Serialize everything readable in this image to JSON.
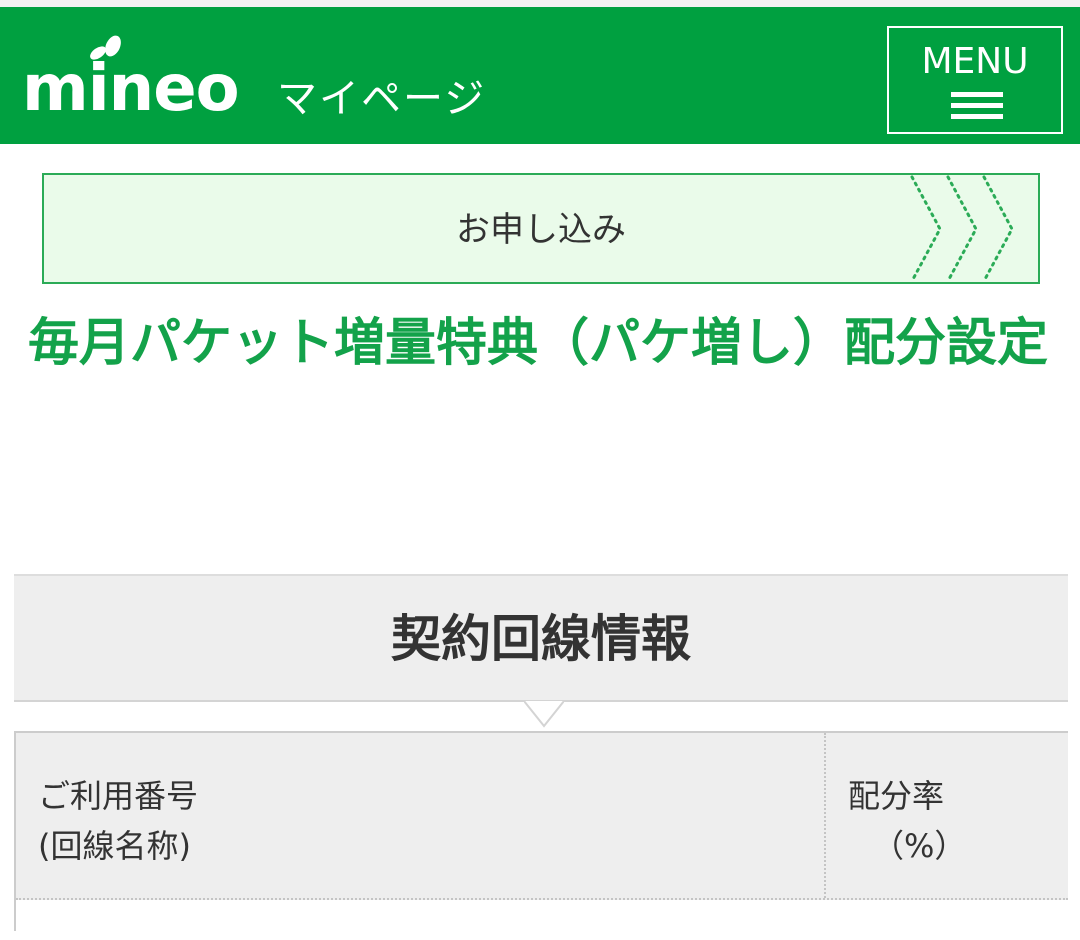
{
  "header": {
    "logo_text": "mineo",
    "logo_subtitle": "マイページ",
    "menu_label": "MENU"
  },
  "apply_banner": {
    "label": "お申し込み"
  },
  "page_title": "毎月パケット増量特典（パケ増し）配分設定",
  "section": {
    "title": "契約回線情報"
  },
  "table": {
    "headers": [
      {
        "line1": "ご利用番号",
        "line2": "(回線名称)"
      },
      {
        "line1": "配分率",
        "line2": "（%）"
      }
    ],
    "rows": []
  },
  "colors": {
    "brand_green": "#00a040",
    "title_green": "#13a24a",
    "banner_bg": "#eafbea",
    "section_bg": "#eeeeee"
  },
  "icons": [
    "logo-sprout-icon",
    "hamburger-icon",
    "chevron-right-arrows-icon",
    "section-caret-icon"
  ]
}
